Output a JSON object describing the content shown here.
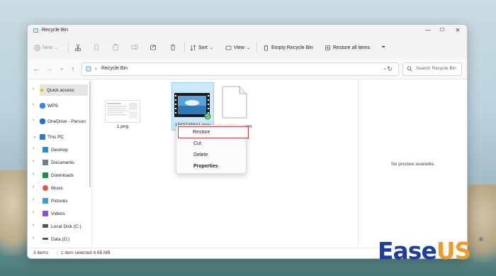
{
  "window": {
    "title": "Recycle Bin"
  },
  "titlebar": {
    "minimize": "—",
    "maximize": "☐",
    "close": "✕"
  },
  "toolbar": {
    "new_label": "New",
    "sort_label": "Sort",
    "view_label": "View",
    "empty_label": "Empty Recycle Bin",
    "restore_all_label": "Restore all items",
    "more_label": "•••"
  },
  "address": {
    "path": "Recycle Bin",
    "search_placeholder": "Search Recycle Bin"
  },
  "sidebar": {
    "items": [
      {
        "label": "Quick access"
      },
      {
        "label": "WPS"
      },
      {
        "label": "OneDrive - Person"
      },
      {
        "label": "This PC"
      },
      {
        "label": "Desktop"
      },
      {
        "label": "Documents"
      },
      {
        "label": "Downloads"
      },
      {
        "label": "Music"
      },
      {
        "label": "Pictures"
      },
      {
        "label": "Videos"
      },
      {
        "label": "Local Disk (C:)"
      },
      {
        "label": "Data (D:)"
      }
    ]
  },
  "files": [
    {
      "name": "1.png"
    },
    {
      "name": "1593745841.mov"
    },
    {
      "name": "dxy_trial.exe.tem"
    }
  ],
  "context_menu": {
    "items": [
      {
        "label": "Restore"
      },
      {
        "label": "Cut"
      },
      {
        "label": "Delete"
      },
      {
        "label": "Properties"
      }
    ]
  },
  "preview": {
    "text": "No preview available."
  },
  "status": {
    "count": "3 items",
    "selected": "1 item selected  4.65 MB"
  },
  "watermark": {
    "brand_a": "Ease",
    "brand_b": "US",
    "reg": "®"
  },
  "colors": {
    "accent": "#0067c0",
    "highlight_box": "#c9413a",
    "selection": "#cce8ff"
  }
}
